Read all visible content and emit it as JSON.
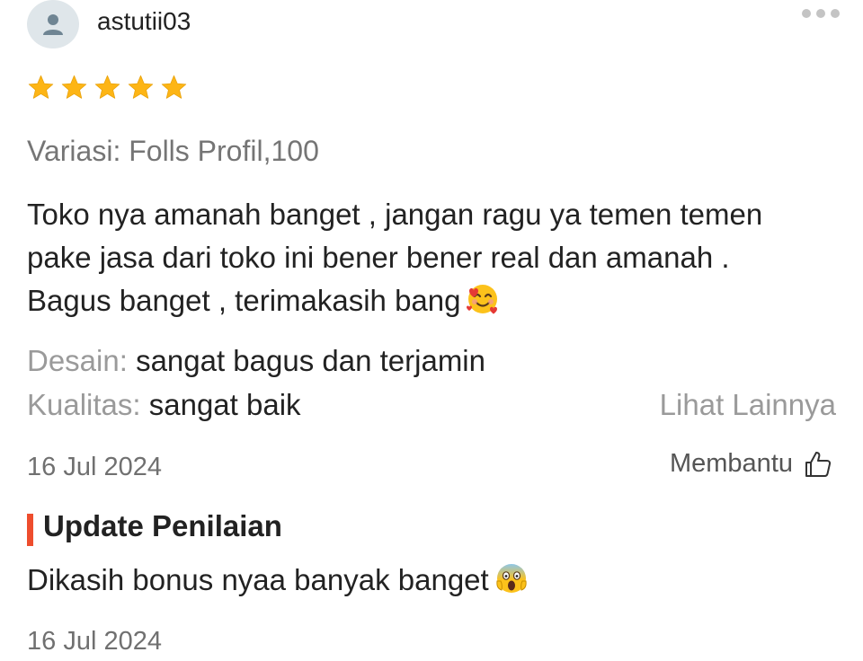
{
  "review": {
    "username": "astutii03",
    "rating": 5,
    "rating_max": 5,
    "star_color": "#fdb515",
    "variant": "Variasi: Folls Profil,100",
    "text_lines": [
      "Toko nya amanah banget , jangan ragu ya temen temen",
      "pake jasa dari toko ini bener bener real dan amanah .",
      "Bagus banget , terimakasih bang"
    ],
    "text_emoji": "smiling-face-with-hearts",
    "attributes": [
      {
        "key": "Desain:",
        "value": "sangat bagus dan terjamin"
      },
      {
        "key": "Kualitas:",
        "value": "sangat baik"
      }
    ],
    "see_more": "Lihat Lainnya",
    "date": "16 Jul 2024",
    "helpful_label": "Membantu",
    "helpful_icon": "thumbs-up-icon"
  },
  "update": {
    "title": "Update Penilaian",
    "accent_color": "#ee4d2d",
    "text": "Dikasih bonus nyaa banyak banget",
    "text_emoji": "screaming-face",
    "date": "16 Jul 2024"
  }
}
